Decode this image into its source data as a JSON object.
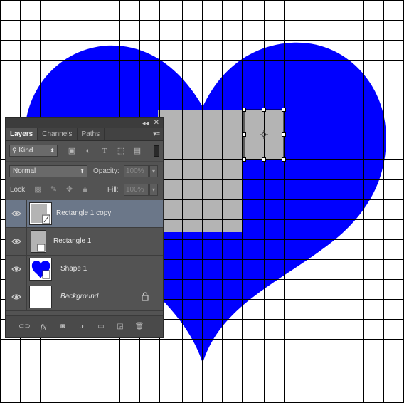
{
  "panel": {
    "collapse_glyph": "◂◂",
    "close_glyph": "✕",
    "menu_glyph": "▾≡"
  },
  "tabs": [
    {
      "label": "Layers",
      "active": true
    },
    {
      "label": "Channels",
      "active": false
    },
    {
      "label": "Paths",
      "active": false
    }
  ],
  "filter": {
    "kind_label": "Kind",
    "icon_names": [
      "search-icon",
      "image-filter-icon",
      "adjustment-filter-icon",
      "type-filter-icon",
      "shape-filter-icon",
      "smart-object-filter-icon"
    ]
  },
  "blend": {
    "mode": "Normal",
    "opacity_label": "Opacity:",
    "opacity_value": "100%"
  },
  "lock": {
    "label": "Lock:",
    "fill_label": "Fill:",
    "fill_value": "100%"
  },
  "layers": [
    {
      "name": "Rectangle 1 copy",
      "selected": true,
      "thumb": "rect-copy"
    },
    {
      "name": "Rectangle 1",
      "selected": false,
      "thumb": "rect"
    },
    {
      "name": "Shape 1",
      "selected": false,
      "thumb": "heart"
    },
    {
      "name": "Background",
      "selected": false,
      "thumb": "white",
      "locked": true
    }
  ],
  "footer_icons": [
    "link-layers-icon",
    "fx-icon",
    "mask-icon",
    "adjustment-icon",
    "folder-icon",
    "new-layer-icon",
    "trash-icon"
  ],
  "colors": {
    "heart": "#0000ff",
    "rectangle": "#b4b4b4",
    "grid": "#000000",
    "panel_bg": "#535353",
    "selected_row": "#6b7789"
  }
}
